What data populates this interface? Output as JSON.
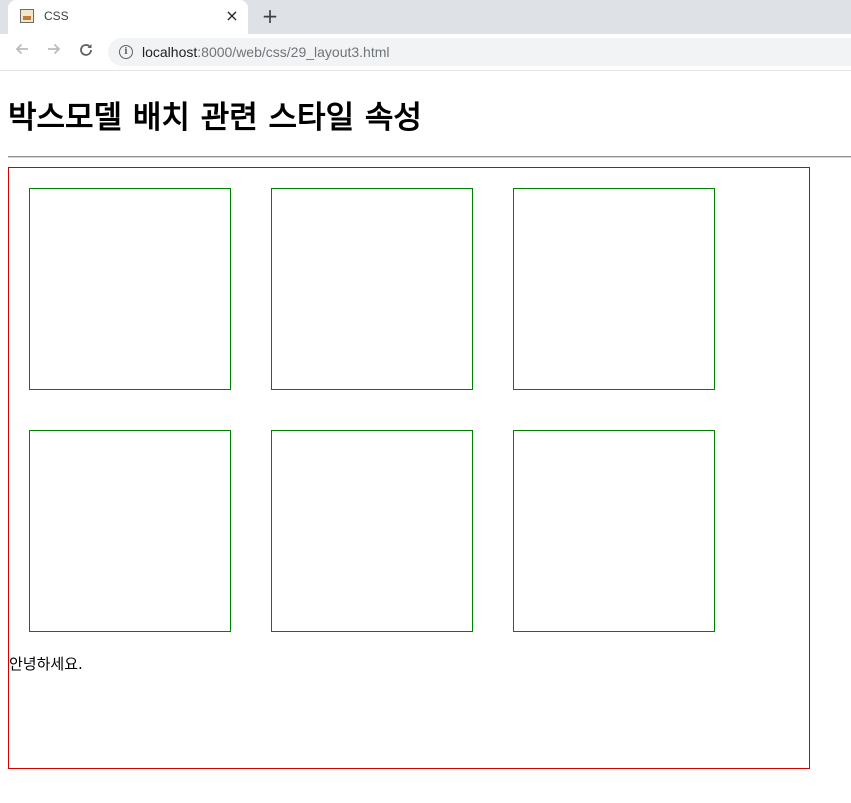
{
  "browser": {
    "tab_title": "CSS",
    "tab_close": "×",
    "new_tab": "+",
    "url_host": "localhost",
    "url_path": ":8000/web/css/29_layout3.html",
    "info_symbol": "i"
  },
  "page": {
    "heading": "박스모델 배치 관련 스타일 속성",
    "greeting": "안녕하세요.",
    "container_border_color": "#d40000",
    "box_border_color": "#008000",
    "box_count": 6
  }
}
